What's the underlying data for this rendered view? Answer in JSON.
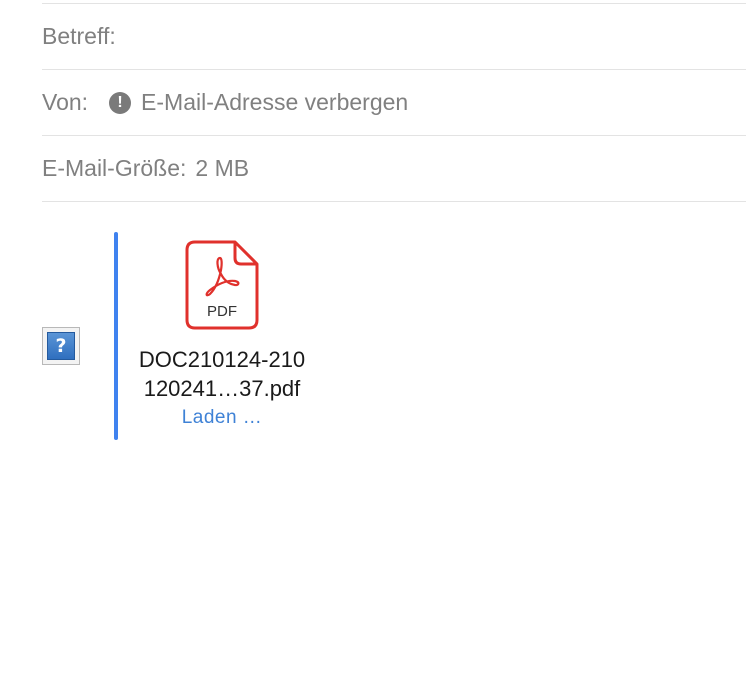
{
  "header": {
    "subject_label": "Betreff:",
    "subject_value": "",
    "from_label": "Von:",
    "from_value": "E-Mail-Adresse verbergen",
    "size_label": "E-Mail-Größe:",
    "size_value": "2 MB"
  },
  "icons": {
    "from_alert": "exclamation-circle-icon",
    "broken_image": "question-mark-icon",
    "attachment": "pdf-file-icon"
  },
  "broken_image_glyph": "?",
  "attachment": {
    "file_type": "PDF",
    "name_line1": "DOC210124-210",
    "name_line2": "120241…37.pdf",
    "action": "Laden …"
  },
  "colors": {
    "quote_bar": "#3f82ef",
    "link": "#3f82d6",
    "pdf_red": "#e0312c"
  }
}
